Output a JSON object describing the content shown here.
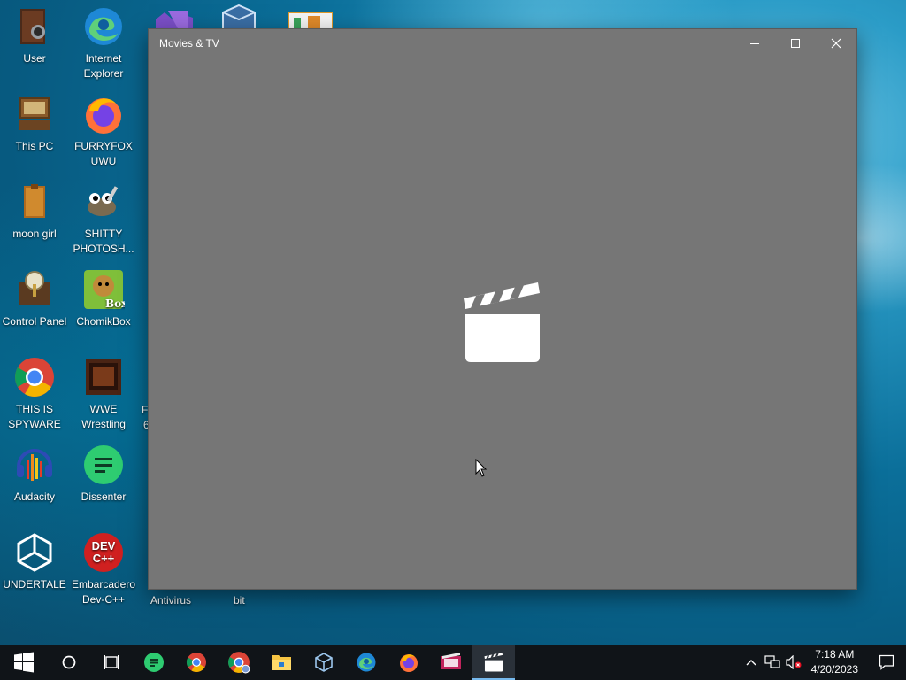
{
  "desktop": {
    "icons": [
      {
        "label": "User",
        "icon": "user-folder-icon"
      },
      {
        "label": "Internet Explorer",
        "icon": "edge-icon"
      },
      {
        "label": "This PC",
        "icon": "computer-icon"
      },
      {
        "label": "FURRYFOX UWU",
        "icon": "firefox-icon"
      },
      {
        "label": "moon girl",
        "icon": "book-icon"
      },
      {
        "label": "SHITTY PHOTOSH...",
        "icon": "gimp-icon"
      },
      {
        "label": "Control Panel",
        "icon": "control-panel-icon"
      },
      {
        "label": "ChomikBox",
        "icon": "chomikbox-icon"
      },
      {
        "label": "THIS IS SPYWARE",
        "icon": "chrome-icon"
      },
      {
        "label": "WWE Wrestling",
        "icon": "wwe-icon"
      },
      {
        "label": "Audacity",
        "icon": "audacity-icon"
      },
      {
        "label": "Dissenter",
        "icon": "dissenter-icon"
      },
      {
        "label": "UNDERTALE",
        "icon": "unity-icon"
      },
      {
        "label": "Embarcadero Dev-C++",
        "icon": "devcpp-icon"
      }
    ],
    "partial_labels": {
      "antivirus": "Antivirus",
      "bit": "bit",
      "col3_row5": "F",
      "col3_row5b": "6"
    }
  },
  "window": {
    "title": "Movies & TV",
    "background": "#767676",
    "minimize_icon": "minimize-icon",
    "maximize_icon": "maximize-icon",
    "close_icon": "close-icon",
    "splash_icon": "clapperboard-icon"
  },
  "taskbar": {
    "items": [
      "start-icon",
      "search-icon",
      "task-view-icon",
      "dissenter-icon",
      "chrome-icon",
      "chrome-alt-icon",
      "file-explorer-icon",
      "virtualbox-icon",
      "edge-icon",
      "firefox-icon",
      "media-app-icon",
      "movies-tv-icon"
    ],
    "active_item": "movies-tv-icon",
    "tray": {
      "time": "7:18 AM",
      "date": "4/20/2023"
    }
  }
}
